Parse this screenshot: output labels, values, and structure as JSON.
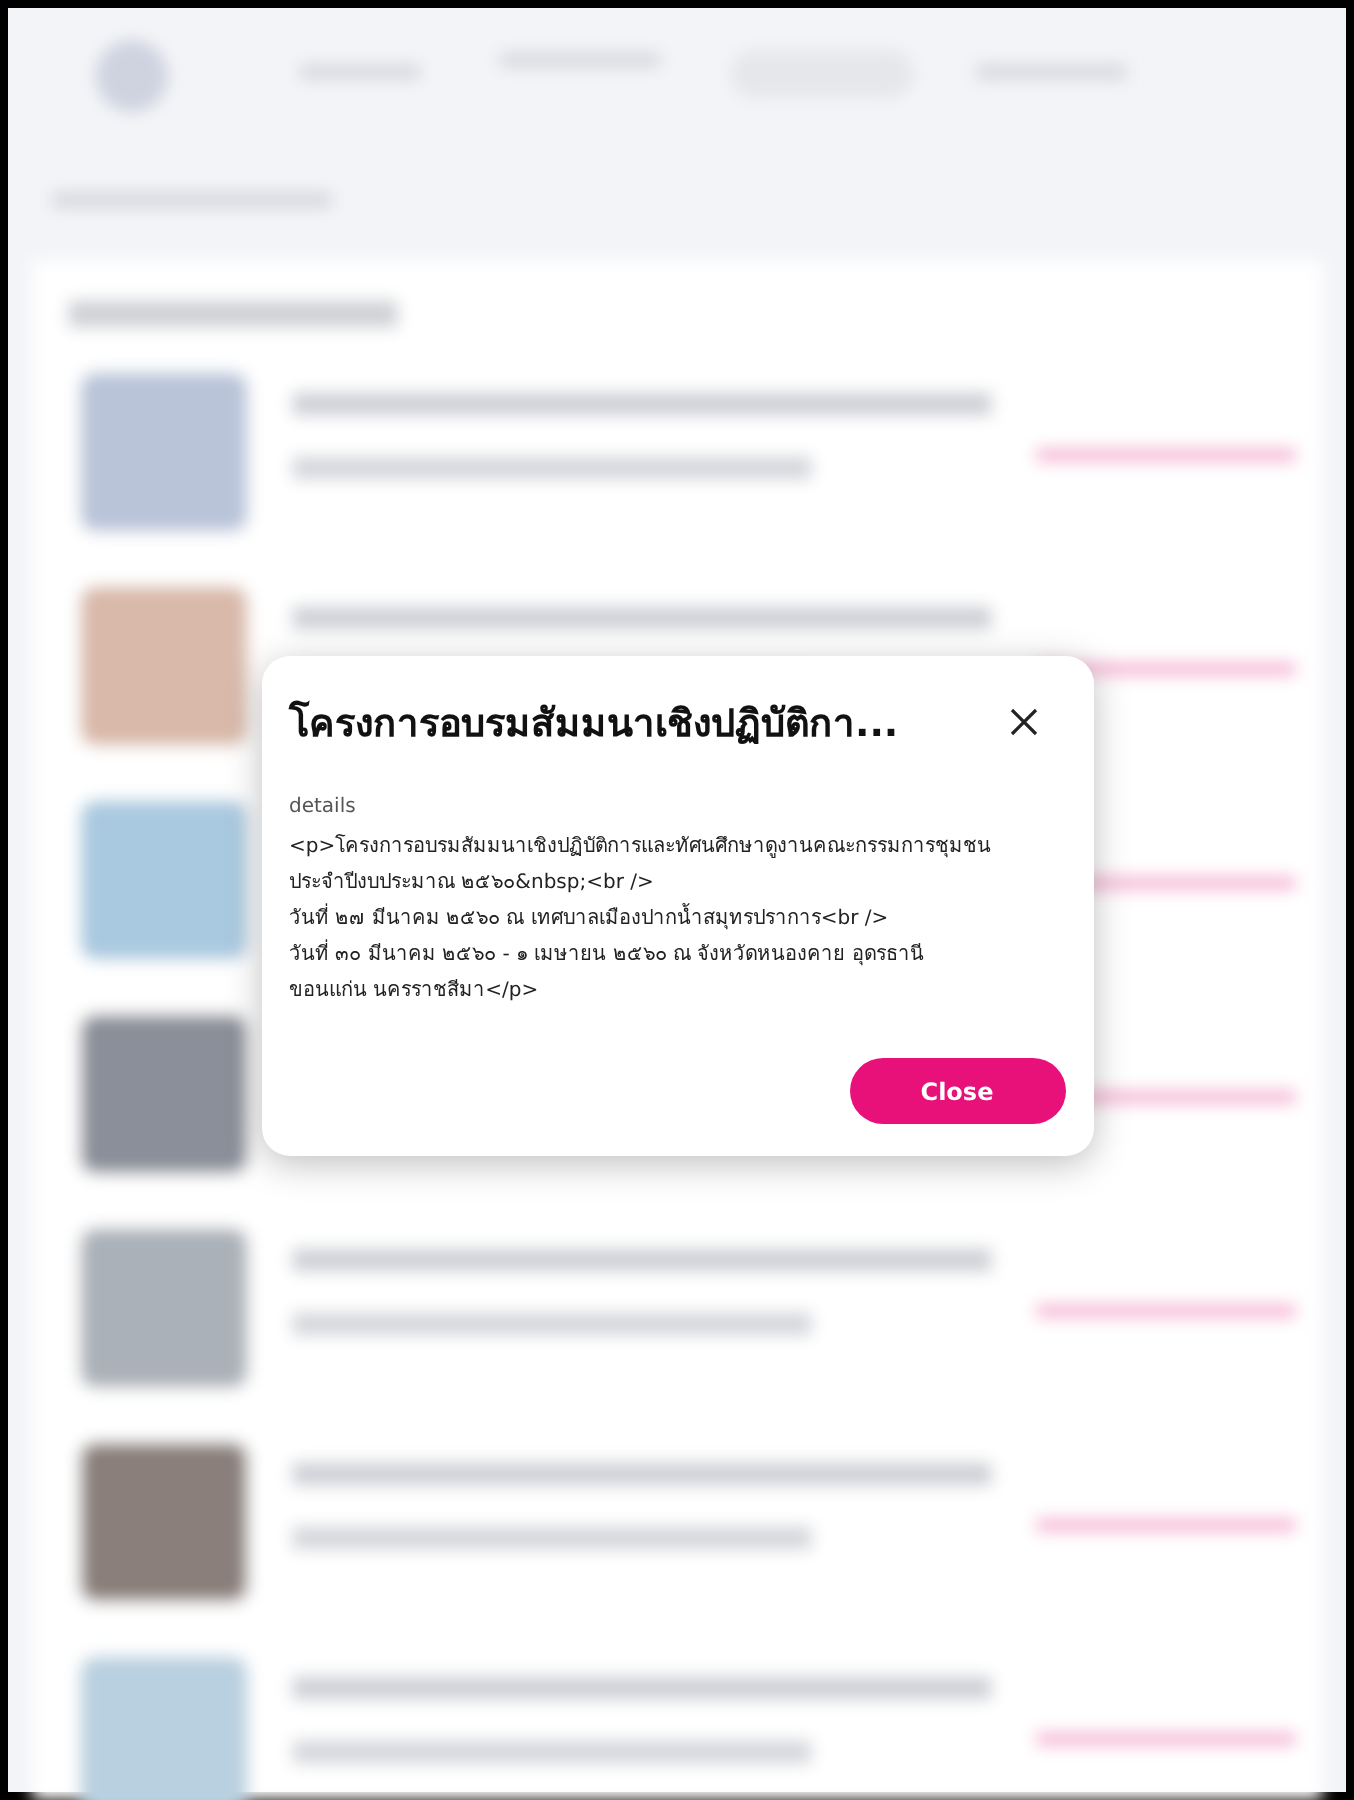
{
  "modal": {
    "title": "โครงการอบรมสัมมนาเชิงปฏิบัติกา...",
    "field_label": "details",
    "details_lines": [
      "<p>โครงการอบรมสัมมนาเชิงปฏิบัติการและทัศนศึกษาดูงานคณะกรรมการชุมชน",
      "ประจำปีงบประมาณ ๒๕๖๐&nbsp;<br />",
      "วันที่ ๒๗ มีนาคม ๒๕๖๐ ณ เทศบาลเมืองปากน้ำสมุทรปราการ<br />",
      "วันที่ ๓๐ มีนาคม ๒๕๖๐ - ๑ เมษายน ๒๕๖๐ ณ จังหวัดหนองคาย อุดรธานี",
      "ขอนแก่น นครราชสีมา</p>"
    ],
    "close_button": "Close"
  }
}
